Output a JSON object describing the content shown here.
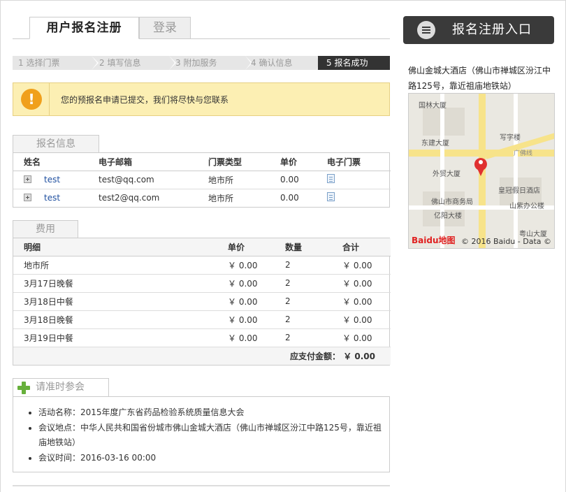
{
  "tabs": {
    "register": "用户报名注册",
    "login": "登录"
  },
  "steps": [
    "1 选择门票",
    "2 填写信息",
    "3 附加服务",
    "4 确认信息",
    "5 报名成功"
  ],
  "notice": {
    "message": "您的预报名申请已提交，我们将尽快与您联系"
  },
  "signup": {
    "section_title": "报名信息",
    "headers": [
      "姓名",
      "电子邮箱",
      "门票类型",
      "单价",
      "电子门票"
    ],
    "rows": [
      {
        "name": "test",
        "email": "test@qq.com",
        "ticket": "地市所",
        "price": "0.00"
      },
      {
        "name": "test",
        "email": "test2@qq.com",
        "ticket": "地市所",
        "price": "0.00"
      }
    ]
  },
  "fees": {
    "section_title": "费用",
    "headers": [
      "明细",
      "单价",
      "数量",
      "合计"
    ],
    "rows": [
      {
        "item": "地市所",
        "price": "￥ 0.00",
        "qty": "2",
        "total": "￥ 0.00"
      },
      {
        "item": "3月17日晚餐",
        "price": "￥ 0.00",
        "qty": "2",
        "total": "￥ 0.00"
      },
      {
        "item": "3月18日中餐",
        "price": "￥ 0.00",
        "qty": "2",
        "total": "￥ 0.00"
      },
      {
        "item": "3月18日晚餐",
        "price": "￥ 0.00",
        "qty": "2",
        "total": "￥ 0.00"
      },
      {
        "item": "3月19日中餐",
        "price": "￥ 0.00",
        "qty": "2",
        "total": "￥ 0.00"
      }
    ],
    "total_label": "应支付金额：",
    "total_value": "￥ 0.00"
  },
  "attend": {
    "section_title": "请准时参会",
    "items": [
      "活动名称：2015年度广东省药品检验系统质量信息大会",
      "会议地点：中华人民共和国省份城市佛山金城大酒店（佛山市禅城区汾江中路125号，靠近祖庙地铁站）",
      "会议时间：2016-03-16 00:00"
    ]
  },
  "sidebar": {
    "register_button": "报名注册入口",
    "hotel": "佛山金城大酒店（佛山市禅城区汾江中路125号，靠近祖庙地铁站）",
    "map_labels": [
      "国林大厦",
      "东建大厦",
      "写字楼",
      "外贸大厦",
      "皇冠假日酒店",
      "佛山市商务局",
      "亿阳大楼",
      "山紫办公楼",
      "粤山大厦",
      "广佛线"
    ],
    "map_logo": "Baidu地图",
    "map_credit": "© 2016 Baidu - Data ©"
  },
  "colors": {
    "notice_bg": "#fcefb3",
    "warning": "#f0a01c",
    "active_step": "#333333",
    "button": "#3a3a3a",
    "link": "#2050a0"
  }
}
